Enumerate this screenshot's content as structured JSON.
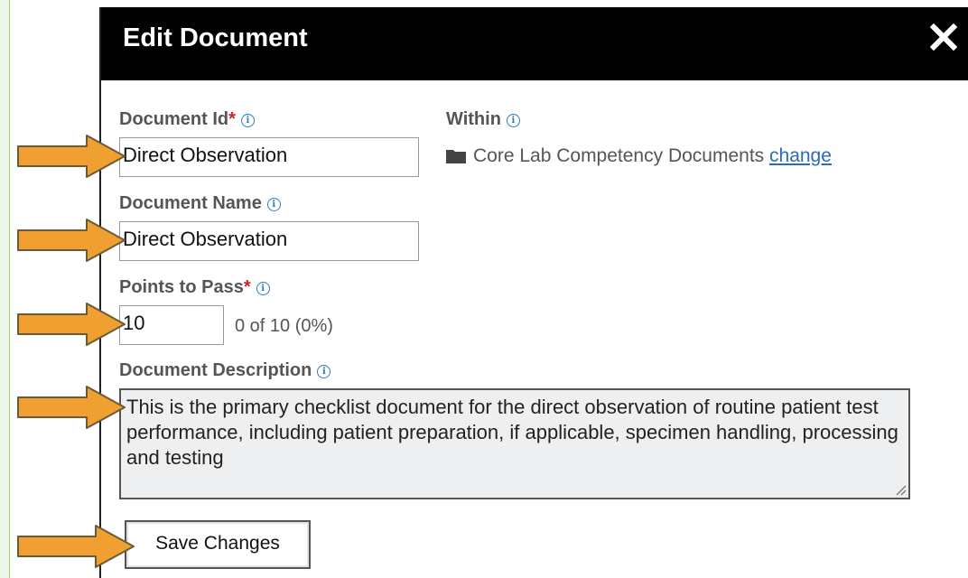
{
  "dialog": {
    "title": "Edit Document"
  },
  "fields": {
    "document_id": {
      "label": "Document Id",
      "required_mark": "*",
      "value": "Direct Observation"
    },
    "within": {
      "label": "Within",
      "folder_name": "Core Lab Competency Documents",
      "change_link": "change"
    },
    "document_name": {
      "label": "Document Name",
      "value": "Direct Observation"
    },
    "points_to_pass": {
      "label": "Points to Pass",
      "required_mark": "*",
      "value": "10",
      "summary": "0 of 10 (0%)"
    },
    "document_description": {
      "label": "Document Description",
      "value": "This is the primary checklist document for the direct observation of routine patient test performance, including patient preparation, if applicable, specimen handling, processing and testing"
    }
  },
  "actions": {
    "save_label": "Save Changes"
  },
  "colors": {
    "titlebar": "#000000",
    "arrow": "#f0a030",
    "link": "#2a6ab8",
    "required": "#cc2222"
  },
  "icons": [
    "close-icon",
    "info-icon",
    "folder-icon",
    "resize-handle-icon",
    "annotation-arrow"
  ]
}
